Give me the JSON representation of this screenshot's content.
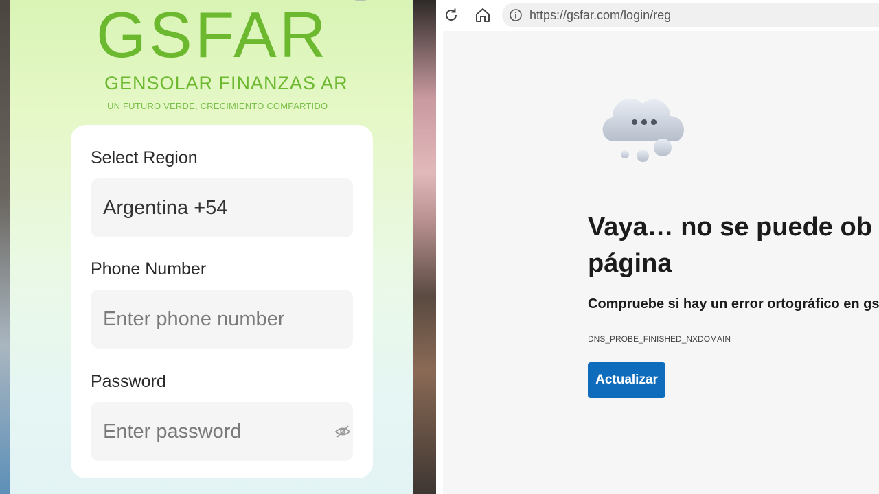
{
  "app": {
    "logo": "GSFAR",
    "brand_name": "GENSOLAR FINANZAS AR",
    "tagline": "UN FUTURO VERDE, CRECIMIENTO COMPARTIDO"
  },
  "login_form": {
    "region": {
      "label": "Select Region",
      "value": "Argentina +54"
    },
    "phone": {
      "label": "Phone Number",
      "placeholder": "Enter phone number"
    },
    "password": {
      "label": "Password",
      "placeholder": "Enter password"
    }
  },
  "browser": {
    "url": "https://gsfar.com/login/reg",
    "error": {
      "title_line1": "Vaya… no se puede ob",
      "title_line2": "página",
      "subtitle": "Compruebe si hay un error ortográfico en gsf",
      "code": "DNS_PROBE_FINISHED_NXDOMAIN",
      "button_label": "Actualizar"
    },
    "icons": [
      "reload-icon",
      "home-icon",
      "info-icon",
      "cloud-icon"
    ]
  },
  "colors": {
    "brand_green": "#6cb82f",
    "button_blue": "#0f6cbd",
    "error_bg": "#f6f6f6"
  }
}
